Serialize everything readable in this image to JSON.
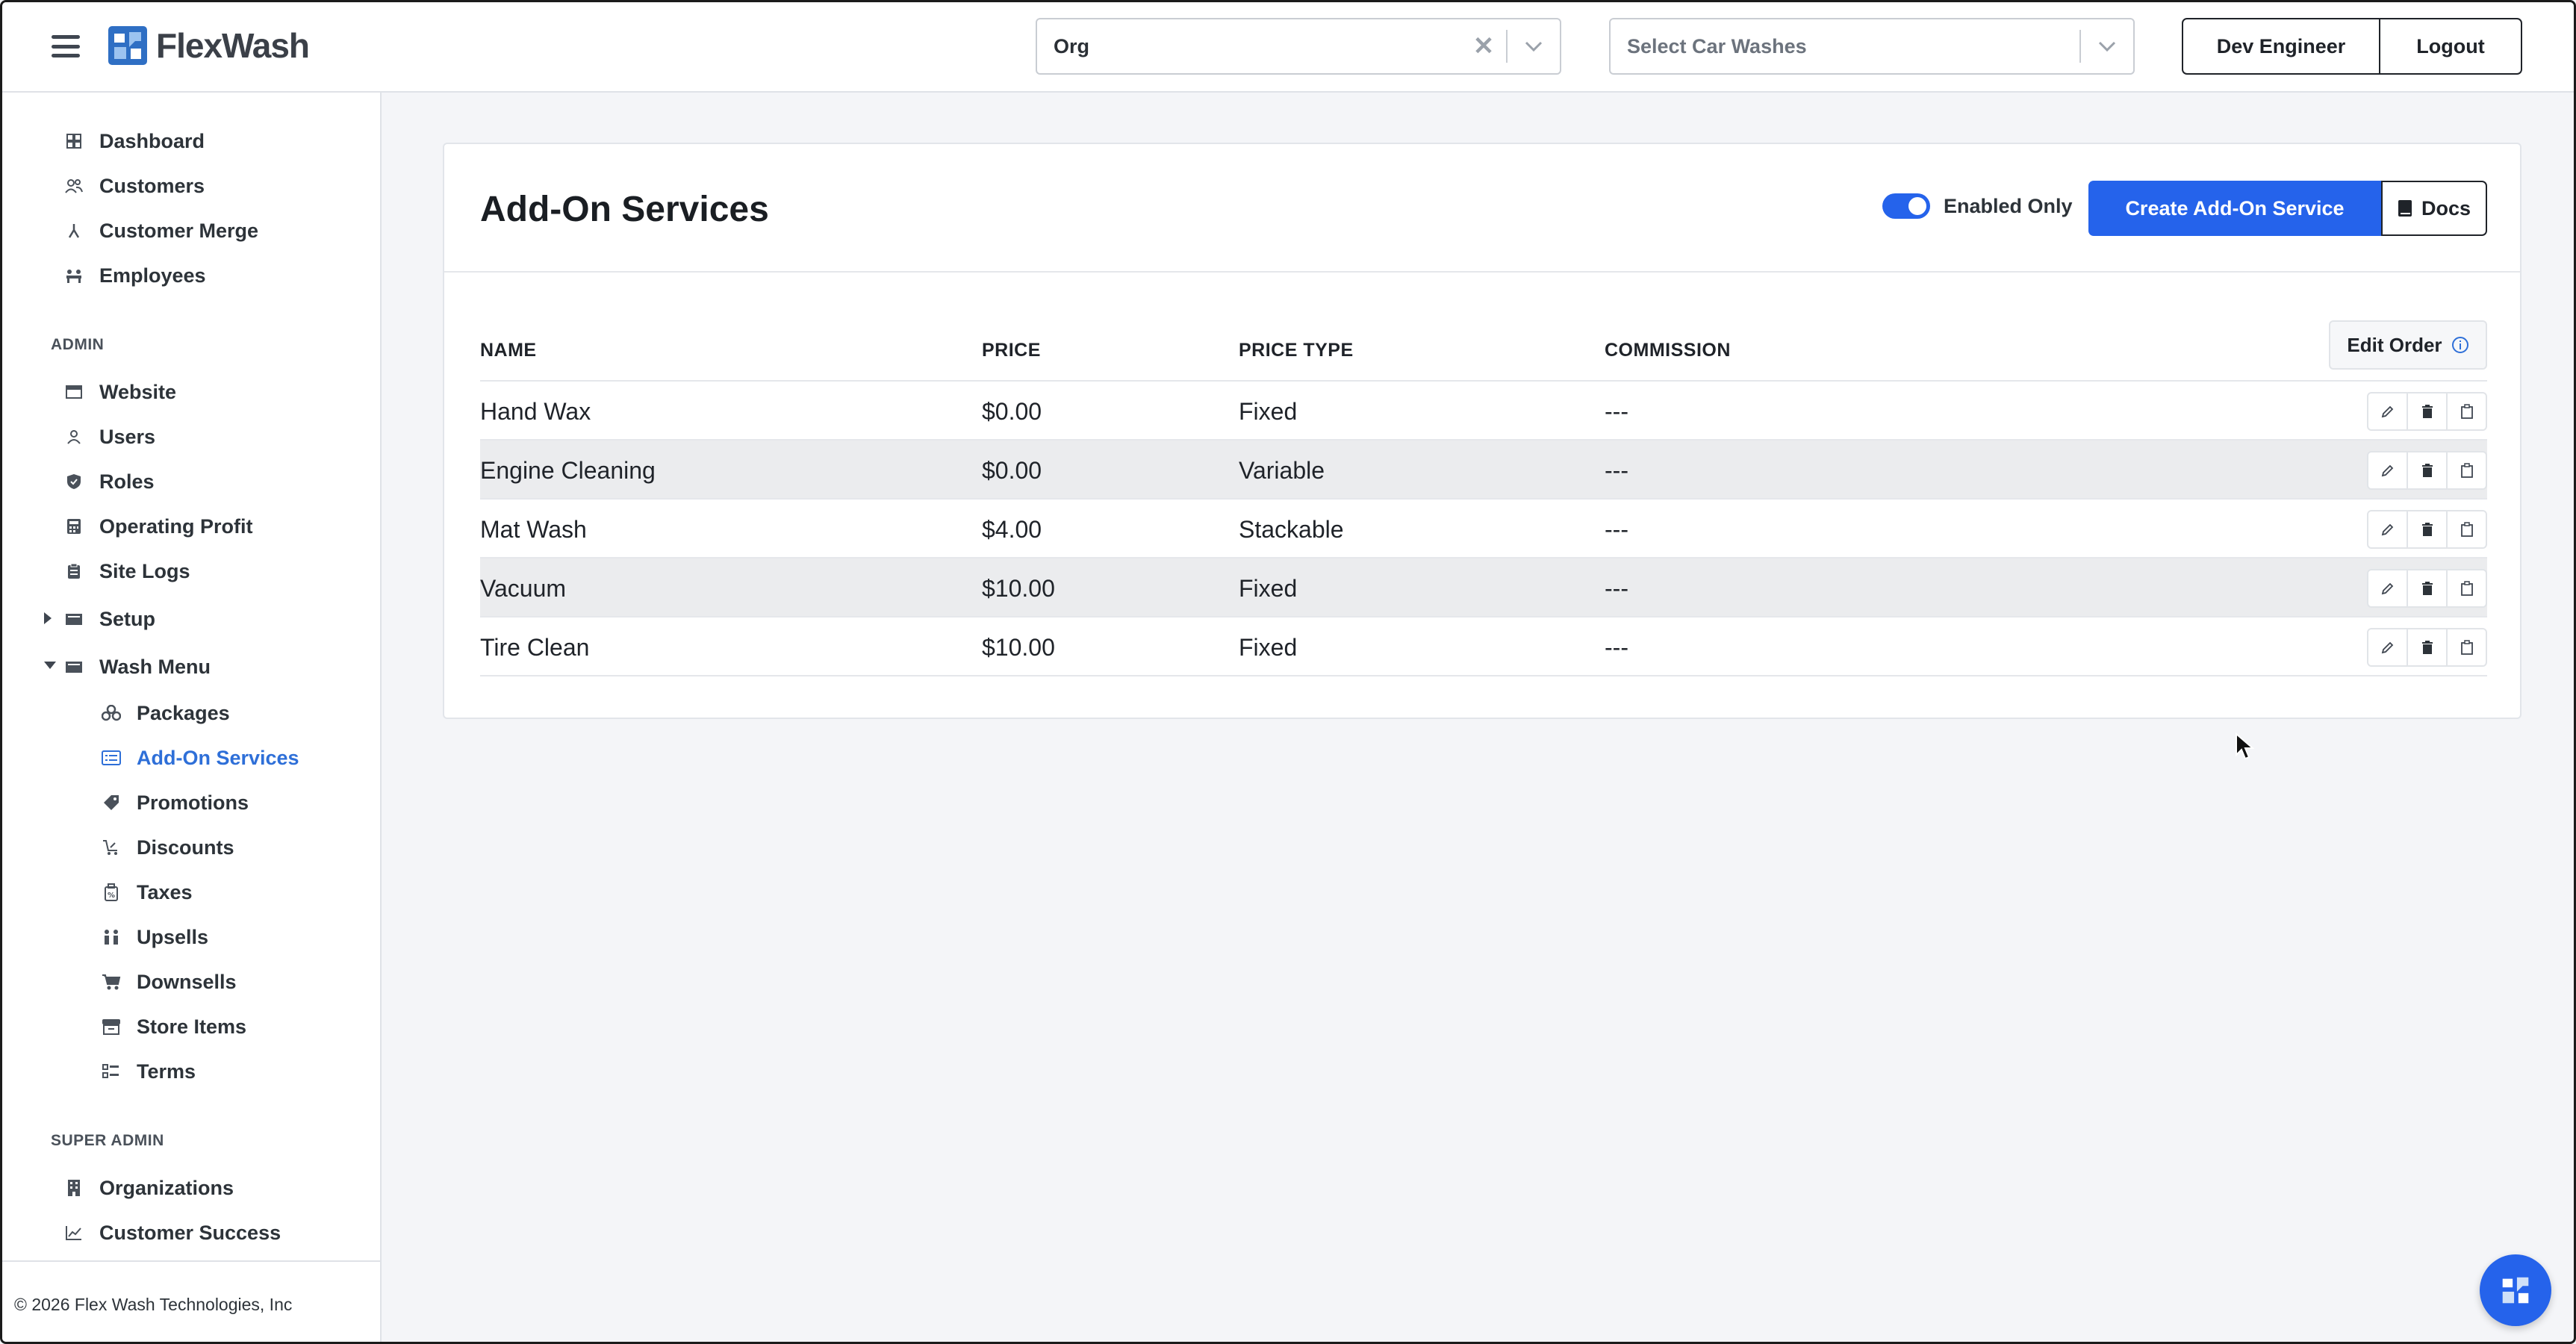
{
  "app": {
    "brand": "FlexWash",
    "accent_color": "#2563eb"
  },
  "topbar": {
    "org_select": {
      "value": "Org",
      "clear_icon": "close-icon",
      "arrow_icon": "chevron-down-icon"
    },
    "carwash_select": {
      "placeholder": "Select Car Washes",
      "arrow_icon": "chevron-down-icon"
    },
    "user_button": "Dev Engineer",
    "logout_button": "Logout"
  },
  "sidebar": {
    "items": [
      {
        "label": "Dashboard",
        "icon": "dashboard-icon"
      },
      {
        "label": "Customers",
        "icon": "users-icon"
      },
      {
        "label": "Customer Merge",
        "icon": "merge-icon"
      },
      {
        "label": "Employees",
        "icon": "employees-icon"
      }
    ],
    "admin_label": "ADMIN",
    "admin_items": [
      {
        "label": "Website",
        "icon": "browser-icon"
      },
      {
        "label": "Users",
        "icon": "user-icon"
      },
      {
        "label": "Roles",
        "icon": "shield-icon"
      },
      {
        "label": "Operating Profit",
        "icon": "calculator-icon"
      },
      {
        "label": "Site Logs",
        "icon": "clipboard-icon"
      },
      {
        "label": "Setup",
        "icon": "folder-icon"
      },
      {
        "label": "Wash Menu",
        "icon": "folder-icon"
      }
    ],
    "wash_menu_items": [
      {
        "label": "Packages",
        "icon": "boxes-icon"
      },
      {
        "label": "Add-On Services",
        "icon": "list-icon",
        "active": true
      },
      {
        "label": "Promotions",
        "icon": "tag-icon"
      },
      {
        "label": "Discounts",
        "icon": "discount-cart-icon"
      },
      {
        "label": "Taxes",
        "icon": "tax-icon"
      },
      {
        "label": "Upsells",
        "icon": "upsell-icon"
      },
      {
        "label": "Downsells",
        "icon": "cart-icon"
      },
      {
        "label": "Store Items",
        "icon": "store-icon"
      },
      {
        "label": "Terms",
        "icon": "terms-icon"
      }
    ],
    "super_admin_label": "SUPER ADMIN",
    "super_admin_items": [
      {
        "label": "Organizations",
        "icon": "building-icon"
      },
      {
        "label": "Customer Success",
        "icon": "chart-line-icon"
      }
    ],
    "copyright": "© 2026 Flex Wash Technologies, Inc"
  },
  "page": {
    "title": "Add-On Services",
    "toggle_label": "Enabled Only",
    "toggle_on": true,
    "create_button": "Create Add-On Service",
    "docs_button": "Docs",
    "edit_order_button": "Edit Order",
    "columns": [
      "NAME",
      "PRICE",
      "PRICE TYPE",
      "COMMISSION"
    ],
    "rows": [
      {
        "name": "Hand Wax",
        "price": "$0.00",
        "price_type": "Fixed",
        "commission": "---"
      },
      {
        "name": "Engine Cleaning",
        "price": "$0.00",
        "price_type": "Variable",
        "commission": "---"
      },
      {
        "name": "Mat Wash",
        "price": "$4.00",
        "price_type": "Stackable",
        "commission": "---"
      },
      {
        "name": "Vacuum",
        "price": "$10.00",
        "price_type": "Fixed",
        "commission": "---"
      },
      {
        "name": "Tire Clean",
        "price": "$10.00",
        "price_type": "Fixed",
        "commission": "---"
      }
    ]
  }
}
